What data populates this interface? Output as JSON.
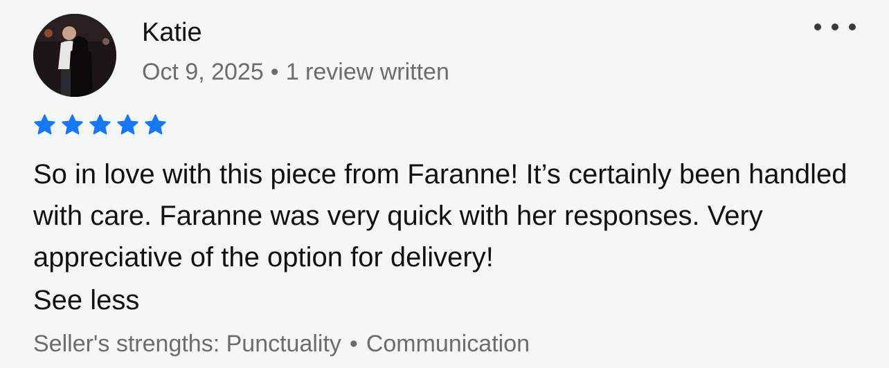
{
  "review": {
    "reviewer_name": "Katie",
    "date": "Oct 9, 2025",
    "separator": "•",
    "review_count": "1 review written",
    "rating": 5,
    "rating_max": 5,
    "text": "So in love with this piece from Faranne! It’s certainly been handled with care. Faranne was very quick with her responses. Very appreciative of the option for delivery!",
    "see_less_label": "See less",
    "strengths_label": "Seller's strengths: Punctuality",
    "strengths_second": "Communication"
  },
  "colors": {
    "star": "#1877f2",
    "muted_text": "#6c6c70",
    "primary_text": "#111111",
    "background": "#f5f7f6"
  },
  "icons": {
    "more": "more-options-icon",
    "star": "star-icon",
    "avatar": "avatar-photo"
  }
}
